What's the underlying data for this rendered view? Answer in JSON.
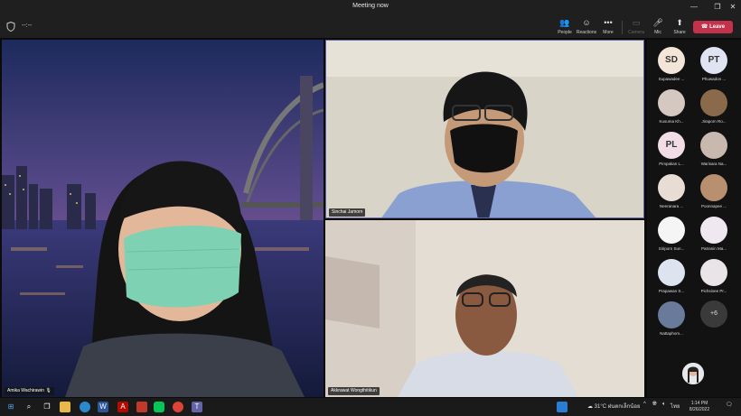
{
  "window": {
    "title": "Meeting now",
    "minimize": "—",
    "restore": "❐",
    "close": "✕"
  },
  "meeting": {
    "timer": "--:--"
  },
  "toolbar": {
    "people": {
      "label": "People",
      "icon": "people-icon"
    },
    "reactions": {
      "label": "Reactions",
      "icon": "reactions-icon"
    },
    "more": {
      "label": "More",
      "icon": "more-icon"
    },
    "camera": {
      "label": "Camera",
      "icon": "camera-off-icon"
    },
    "mic": {
      "label": "Mic",
      "icon": "mic-icon"
    },
    "share": {
      "label": "Share",
      "icon": "share-icon"
    },
    "leave": {
      "label": "Leave",
      "color": "#c4314b"
    }
  },
  "videos": [
    {
      "name": "Amika Wachirawin"
    },
    {
      "name": "Sinchai Jamorn"
    },
    {
      "name": "Akkrawat Wongthitikun"
    }
  ],
  "roster": {
    "people": [
      {
        "name": "Supawadee ...",
        "initials": "SD",
        "color": "#f3e6d8"
      },
      {
        "name": "Phuwadon ...",
        "initials": "PT",
        "color": "#dfe3f2"
      },
      {
        "name": "Kusuma Kh...",
        "initials": "",
        "color": "#d4c8c0"
      },
      {
        "name": "Jiraporn Ro...",
        "initials": "",
        "color": "#8a6a4a"
      },
      {
        "name": "Pimpakan L...",
        "initials": "PL",
        "color": "#f2dde6"
      },
      {
        "name": "Warisara Na...",
        "initials": "",
        "color": "#c9b8ae"
      },
      {
        "name": "Neeranara ...",
        "initials": "",
        "color": "#e8ddd4"
      },
      {
        "name": "Poonnapee ...",
        "initials": "",
        "color": "#b89070"
      },
      {
        "name": "Siriporn Sun...",
        "initials": "",
        "color": "#f5f5f5"
      },
      {
        "name": "Patranin Ma...",
        "initials": "",
        "color": "#f0e8f0"
      },
      {
        "name": "Prapawan S...",
        "initials": "",
        "color": "#dde4f0"
      },
      {
        "name": "Pichsinee Pr...",
        "initials": "",
        "color": "#e8e4e8"
      },
      {
        "name": "Nattaphom...",
        "initials": "",
        "color": "#6a7a9a"
      }
    ],
    "more_count": "+6"
  },
  "taskbar": {
    "weather": "31°C ฝนตกเล็กน้อย",
    "lang": "ไทย",
    "time": "1:14 PM",
    "date": "8/26/2022"
  }
}
